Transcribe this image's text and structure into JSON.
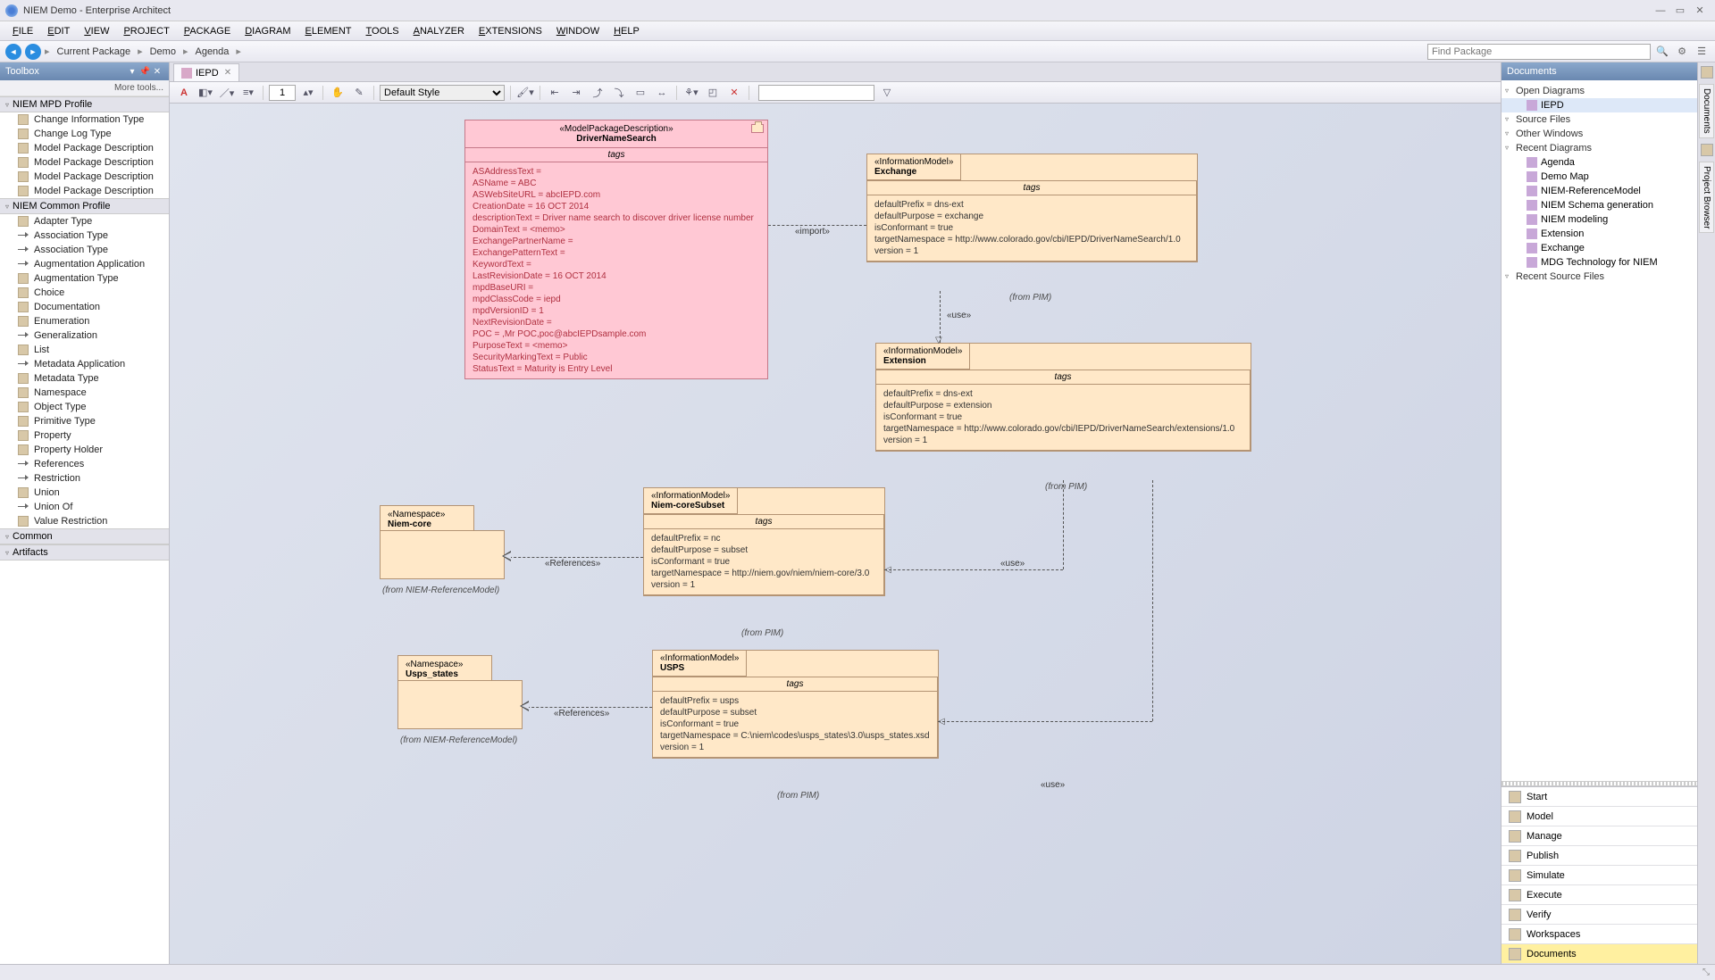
{
  "app": {
    "title": "NIEM Demo - Enterprise Architect"
  },
  "menus": [
    "FILE",
    "EDIT",
    "VIEW",
    "PROJECT",
    "PACKAGE",
    "DIAGRAM",
    "ELEMENT",
    "TOOLS",
    "ANALYZER",
    "EXTENSIONS",
    "WINDOW",
    "HELP"
  ],
  "breadcrumbs": [
    "Current Package",
    "Demo",
    "Agenda"
  ],
  "find_placeholder": "Find Package",
  "toolbox": {
    "title": "Toolbox",
    "more": "More tools...",
    "sections": [
      {
        "name": "NIEM MPD Profile",
        "items": [
          "Change Information Type",
          "Change Log Type",
          "Model Package Description",
          "Model Package Description",
          "Model Package Description",
          "Model Package Description"
        ]
      },
      {
        "name": "NIEM Common Profile",
        "items": [
          "Adapter Type",
          "Association Type",
          "Association Type",
          "Augmentation Application",
          "Augmentation Type",
          "Choice",
          "Documentation",
          "Enumeration",
          "Generalization",
          "List",
          "Metadata Application",
          "Metadata Type",
          "Namespace",
          "Object Type",
          "Primitive Type",
          "Property",
          "Property Holder",
          "References",
          "Restriction",
          "Union",
          "Union Of",
          "Value Restriction"
        ]
      },
      {
        "name": "Common",
        "items": []
      },
      {
        "name": "Artifacts",
        "items": []
      }
    ]
  },
  "tab": {
    "label": "IEPD"
  },
  "diag_toolbar": {
    "zoom": "1",
    "style": "Default Style"
  },
  "mpd": {
    "stereo": "«ModelPackageDescription»",
    "name": "DriverNameSearch",
    "tags_label": "tags",
    "lines": [
      "ASAddressText =",
      "ASName = ABC",
      "ASWebSiteURL = abcIEPD.com",
      "CreationDate = 16 OCT 2014",
      "descriptionText = Driver name search to discover driver license number",
      "DomainText = <memo>",
      "ExchangePartnerName =",
      "ExchangePatternText =",
      "KeywordText =",
      "LastRevisionDate = 16 OCT 2014",
      "mpdBaseURI =",
      "mpdClassCode = iepd",
      "mpdVersionID = 1",
      "NextRevisionDate =",
      "POC = ,Mr POC,poc@abcIEPDsample.com",
      "PurposeText = <memo>",
      "SecurityMarkingText = Public",
      "StatusText = Maturity is Entry Level"
    ]
  },
  "exchange": {
    "stereo": "«InformationModel»",
    "name": "Exchange",
    "tags_label": "tags",
    "lines": [
      "defaultPrefix = dns-ext",
      "defaultPurpose = exchange",
      "isConformant = true",
      "targetNamespace = http://www.colorado.gov/cbi/IEPD/DriverNameSearch/1.0",
      "version = 1"
    ],
    "from": "(from PIM)"
  },
  "extension": {
    "stereo": "«InformationModel»",
    "name": "Extension",
    "tags_label": "tags",
    "lines": [
      "defaultPrefix = dns-ext",
      "defaultPurpose = extension",
      "isConformant = true",
      "targetNamespace = http://www.colorado.gov/cbi/IEPD/DriverNameSearch/extensions/1.0",
      "version = 1"
    ],
    "from": "(from PIM)"
  },
  "niemcore": {
    "stereo": "«InformationModel»",
    "name": "Niem-coreSubset",
    "tags_label": "tags",
    "lines": [
      "defaultPrefix = nc",
      "defaultPurpose = subset",
      "isConformant = true",
      "targetNamespace = http://niem.gov/niem/niem-core/3.0",
      "version = 1"
    ],
    "from": "(from PIM)"
  },
  "usps": {
    "stereo": "«InformationModel»",
    "name": "USPS",
    "tags_label": "tags",
    "lines": [
      "defaultPrefix = usps",
      "defaultPurpose = subset",
      "isConformant = true",
      "targetNamespace = C:\\niem\\codes\\usps_states\\3.0\\usps_states.xsd",
      "version = 1"
    ],
    "from": "(from PIM)"
  },
  "ns_niemcore": {
    "stereo": "«Namespace»",
    "name": "Niem-core",
    "from": "(from NIEM-ReferenceModel)"
  },
  "ns_usps": {
    "stereo": "«Namespace»",
    "name": "Usps_states",
    "from": "(from NIEM-ReferenceModel)"
  },
  "labels": {
    "import": "«import»",
    "use": "«use»",
    "references": "«References»"
  },
  "documents": {
    "title": "Documents",
    "sections": [
      {
        "name": "Open Diagrams",
        "items": [
          "IEPD"
        ],
        "selectedIndex": 0
      },
      {
        "name": "Source Files",
        "items": []
      },
      {
        "name": "Other Windows",
        "items": []
      },
      {
        "name": "Recent Diagrams",
        "items": [
          "Agenda",
          "Demo Map",
          "NIEM-ReferenceModel",
          "NIEM Schema generation",
          "NIEM modeling",
          "Extension",
          "Exchange",
          "MDG Technology for NIEM"
        ]
      },
      {
        "name": "Recent Source Files",
        "items": []
      }
    ],
    "bottom": [
      "Start",
      "Model",
      "Manage",
      "Publish",
      "Simulate",
      "Execute",
      "Verify",
      "Workspaces",
      "Documents"
    ],
    "activeBottom": 8
  },
  "farright": {
    "tabs": [
      "Documents",
      "Project Browser"
    ]
  }
}
